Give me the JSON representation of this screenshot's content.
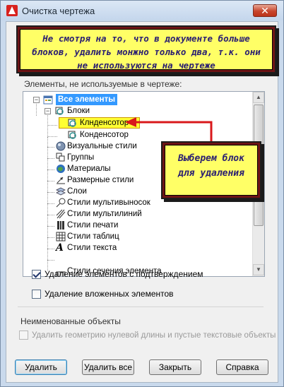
{
  "window": {
    "title": "Очистка чертежа",
    "close_glyph": "✕"
  },
  "note_top": {
    "text": "Не смотря на то, что в документе больше блоков, удалить монжно только два, т.к. они не используются на чертеже"
  },
  "tree_section": {
    "label": "Элементы, не используемые в чертеже:",
    "items": [
      {
        "label": "Все элементы",
        "icon": "all-items-icon"
      },
      {
        "label": "Блоки",
        "icon": "blocks-icon"
      },
      {
        "label": "Клнденсотор",
        "icon": "block-item-icon"
      },
      {
        "label": "Конденсотор",
        "icon": "block-item-icon"
      },
      {
        "label": "Визуальные стили",
        "icon": "visual-styles-icon"
      },
      {
        "label": "Группы",
        "icon": "groups-icon"
      },
      {
        "label": "Материалы",
        "icon": "materials-icon"
      },
      {
        "label": "Размерные стили",
        "icon": "dimension-styles-icon"
      },
      {
        "label": "Слои",
        "icon": "layers-icon"
      },
      {
        "label": "Стили мультивыносок",
        "icon": "multileader-styles-icon"
      },
      {
        "label": "Стили мультилиний",
        "icon": "mline-styles-icon"
      },
      {
        "label": "Стили печати",
        "icon": "plot-styles-icon"
      },
      {
        "label": "Стили таблиц",
        "icon": "table-styles-icon"
      },
      {
        "label": "Стили текста",
        "icon": "text-styles-icon"
      },
      {
        "label": "Стили сечения элемента",
        "icon": "section-styles-icon"
      }
    ]
  },
  "callout": {
    "text": "Выберем блок для удаления"
  },
  "options": {
    "confirm_label": "Удаление элементов с подтверждением",
    "confirm_checked": true,
    "nested_label": "Удаление вложенных элементов",
    "nested_checked": false
  },
  "unnamed": {
    "title": "Неименованные объекты",
    "zero_geom_label": "Удалить геометрию нулевой длины и пустые текстовые объекты",
    "zero_geom_checked": false
  },
  "buttons": {
    "purge": "Удалить",
    "purge_all": "Удалить все",
    "close": "Закрыть",
    "help": "Справка"
  },
  "colors": {
    "callout_fill": "#ffff66",
    "callout_border": "#6e1515",
    "arrow": "#d9181b",
    "selection": "#3399ff"
  }
}
